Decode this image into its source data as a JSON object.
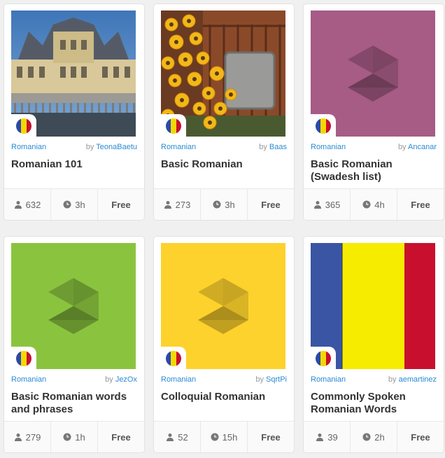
{
  "flag_colors": [
    "#2b4aa6",
    "#f5d800",
    "#c8102e"
  ],
  "courses": [
    {
      "language": "Romanian",
      "by": "by",
      "author": "TeonaBaetu",
      "title": "Romanian 101",
      "learners": "632",
      "duration": "3h",
      "price": "Free",
      "thumb": "palace-photo"
    },
    {
      "language": "Romanian",
      "by": "by",
      "author": "Baas",
      "title": "Basic Romanian",
      "learners": "273",
      "duration": "3h",
      "price": "Free",
      "thumb": "flowers-photo"
    },
    {
      "language": "Romanian",
      "by": "by",
      "author": "Ancanar",
      "title": "Basic Romanian (Swadesh list)",
      "learners": "365",
      "duration": "4h",
      "price": "Free",
      "thumb": "logo-mauve",
      "color": "#a65c85"
    },
    {
      "language": "Romanian",
      "by": "by",
      "author": "JezOx",
      "title": "Basic Romanian words and phrases",
      "learners": "279",
      "duration": "1h",
      "price": "Free",
      "thumb": "logo-green",
      "color": "#8ac43f"
    },
    {
      "language": "Romanian",
      "by": "by",
      "author": "SqrtPi",
      "title": "Colloquial Romanian",
      "learners": "52",
      "duration": "15h",
      "price": "Free",
      "thumb": "logo-yellow",
      "color": "#fdd22c"
    },
    {
      "language": "Romanian",
      "by": "by",
      "author": "aemartinez",
      "title": "Commonly Spoken Romanian Words",
      "learners": "39",
      "duration": "2h",
      "price": "Free",
      "thumb": "romanian-flag-image"
    }
  ]
}
